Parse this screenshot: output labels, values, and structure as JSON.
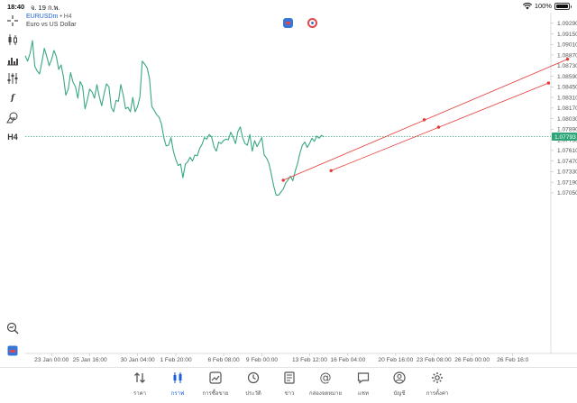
{
  "status": {
    "time": "18:40",
    "date": "จ. 19 ก.พ.",
    "battery": "100%",
    "battery_level": 1.0
  },
  "chart_header": {
    "symbol": "EURUSDm",
    "separator": " • ",
    "timeframe": "H4",
    "description": "Euro vs US Dollar"
  },
  "toolbar": {
    "timeframe_label": "H4"
  },
  "colors": {
    "line": "#3aa882",
    "current_price_bg": "#2ea579",
    "trend_lines": "#e53935",
    "active_tab": "#1e5fd8"
  },
  "chart_data": {
    "type": "line",
    "symbol": "EURUSDm",
    "timeframe": "H4",
    "ylim": [
      1.0493,
      1.0943
    ],
    "y_ticks": [
      "1.09290",
      "1.09150",
      "1.09010",
      "1.08870",
      "1.08730",
      "1.08590",
      "1.08450",
      "1.08310",
      "1.08170",
      "1.08030",
      "1.07890",
      "1.07750",
      "1.07610",
      "1.07470",
      "1.07330",
      "1.07190",
      "1.07050"
    ],
    "y_tick_values": [
      1.0929,
      1.0915,
      1.0901,
      1.0887,
      1.0873,
      1.0859,
      1.0845,
      1.0831,
      1.0817,
      1.0803,
      1.0789,
      1.0775,
      1.0761,
      1.0747,
      1.0733,
      1.0719,
      1.0705
    ],
    "current_price": "1.07793",
    "current_price_value": 1.07793,
    "x_ticks": [
      "23 Jan 00:00",
      "25 Jan 16:00",
      "30 Jan 04:00",
      "1 Feb 20:00",
      "6 Feb 08:00",
      "9 Feb 00:00",
      "13 Feb 12:00",
      "16 Feb 04:00",
      "20 Feb 16:00",
      "23 Feb 08:00",
      "26 Feb 00:00",
      "26 Feb 16:0"
    ],
    "bar_count": 220,
    "x_tick_bar_index": [
      5,
      21,
      41,
      57,
      77,
      93,
      113,
      129,
      149,
      165,
      181,
      198
    ],
    "series": [
      {
        "values": [
          1.0886,
          1.0879,
          1.0889,
          1.0906,
          1.0872,
          1.0866,
          1.0862,
          1.0878,
          1.0896,
          1.0885,
          1.0873,
          1.0881,
          1.0893,
          1.0885,
          1.0868,
          1.0874,
          1.0858,
          1.0834,
          1.0842,
          1.0864,
          1.0851,
          1.0845,
          1.083,
          1.0852,
          1.0846,
          1.0816,
          1.0828,
          1.0842,
          1.0838,
          1.083,
          1.0848,
          1.0832,
          1.082,
          1.0836,
          1.0849,
          1.0845,
          1.0818,
          1.0812,
          1.0827,
          1.0826,
          1.0848,
          1.0834,
          1.0816,
          1.0818,
          1.0812,
          1.0831,
          1.0812,
          1.0819,
          1.0832,
          1.0879,
          1.0875,
          1.087,
          1.0856,
          1.0819,
          1.0814,
          1.0808,
          1.0805,
          1.0796,
          1.0778,
          1.0767,
          1.0768,
          1.0778,
          1.076,
          1.0749,
          1.0741,
          1.0743,
          1.0725,
          1.0743,
          1.0746,
          1.0752,
          1.0747,
          1.0755,
          1.0754,
          1.0764,
          1.0769,
          1.0778,
          1.0776,
          1.0782,
          1.0779,
          1.0766,
          1.076,
          1.0772,
          1.077,
          1.0774,
          1.0776,
          1.0775,
          1.0785,
          1.0779,
          1.077,
          1.0786,
          1.0792,
          1.0778,
          1.077,
          1.0768,
          1.0782,
          1.076,
          1.0774,
          1.0766,
          1.0772,
          1.0778,
          1.0755,
          1.0751,
          1.0744,
          1.073,
          1.0714,
          1.0702,
          1.0702,
          1.0706,
          1.071,
          1.0718,
          1.0722,
          1.0727,
          1.0721,
          1.0734,
          1.0744,
          1.0758,
          1.0768,
          1.0772,
          1.0765,
          1.077,
          1.0777,
          1.0773,
          1.078,
          1.0777,
          1.0781,
          1.0779
        ],
        "note_x": "values are spaced evenly from bar 0 to bar 125"
      }
    ],
    "trend_lines": [
      {
        "x1": 108,
        "y1": 1.07217,
        "x2": 227,
        "y2": 1.08815,
        "mid_x": 167,
        "mid_y": 1.08015
      },
      {
        "x1": 128,
        "y1": 1.07343,
        "x2": 219,
        "y2": 1.085,
        "mid_x": 173,
        "mid_y": 1.07917
      }
    ],
    "grid": false
  },
  "tabs": [
    {
      "label": "ราคา",
      "icon": "quotes-icon"
    },
    {
      "label": "กราฟ",
      "icon": "chart-icon"
    },
    {
      "label": "การซื้อขาย",
      "icon": "trade-icon"
    },
    {
      "label": "ประวัติ",
      "icon": "history-icon"
    },
    {
      "label": "ข่าว",
      "icon": "news-icon"
    },
    {
      "label": "กล่องจดหมาย",
      "icon": "mailbox-icon"
    },
    {
      "label": "แชท",
      "icon": "chat-icon"
    },
    {
      "label": "บัญชี",
      "icon": "account-icon"
    },
    {
      "label": "การตั้งค่า",
      "icon": "settings-icon"
    }
  ],
  "active_tab": "กราฟ"
}
